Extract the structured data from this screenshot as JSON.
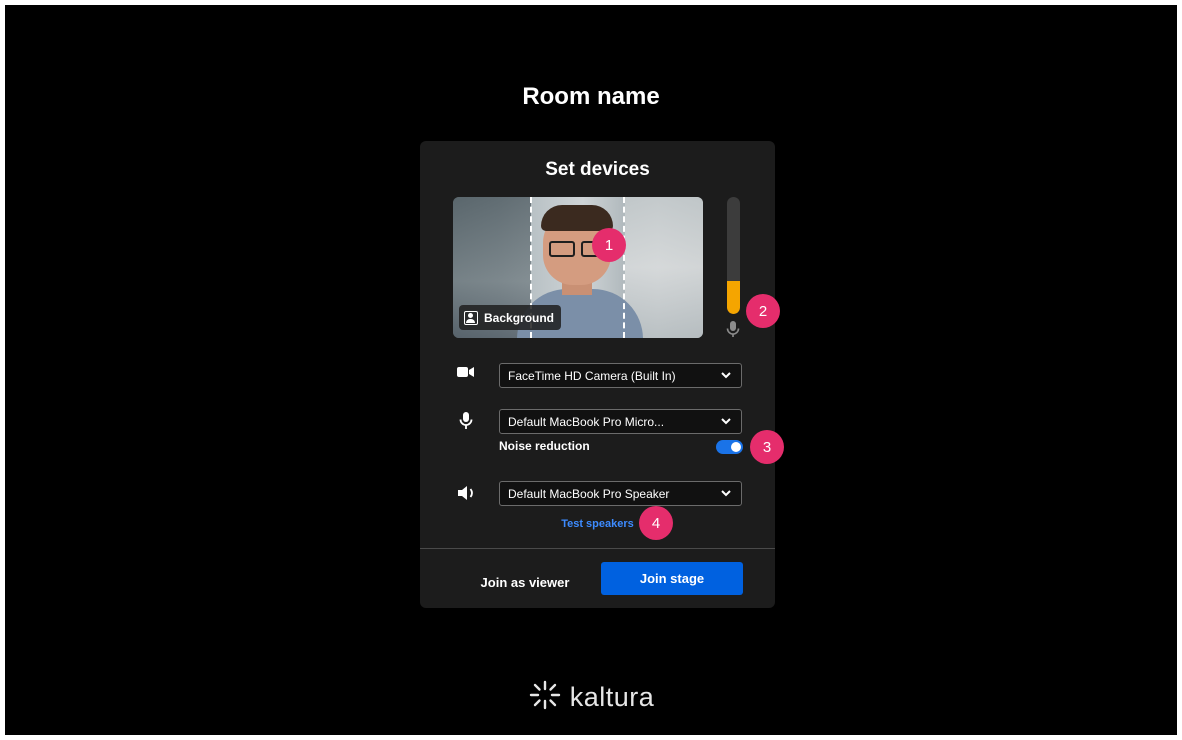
{
  "room": {
    "title": "Room name"
  },
  "panel": {
    "title": "Set devices",
    "background_button": "Background",
    "mic_level_percent": 28,
    "camera": {
      "selected": "FaceTime HD Camera (Built In)"
    },
    "microphone": {
      "selected": "Default MacBook Pro Micro...",
      "noise_label": "Noise reduction",
      "noise_on": true
    },
    "speaker": {
      "selected": "Default MacBook Pro Speaker",
      "test_label": "Test speakers"
    },
    "actions": {
      "viewer": "Join as viewer",
      "stage": "Join stage"
    }
  },
  "markers": [
    "1",
    "2",
    "3",
    "4"
  ],
  "brand": {
    "name": "kaltura"
  },
  "colors": {
    "accent": "#0061e0",
    "link": "#3d8bff",
    "meter": "#f5a500",
    "marker": "#e52d6c"
  },
  "icons": [
    "camera-icon",
    "microphone-icon",
    "speaker-icon",
    "chevron-down-icon",
    "background-icon",
    "kaltura-logo-icon"
  ]
}
